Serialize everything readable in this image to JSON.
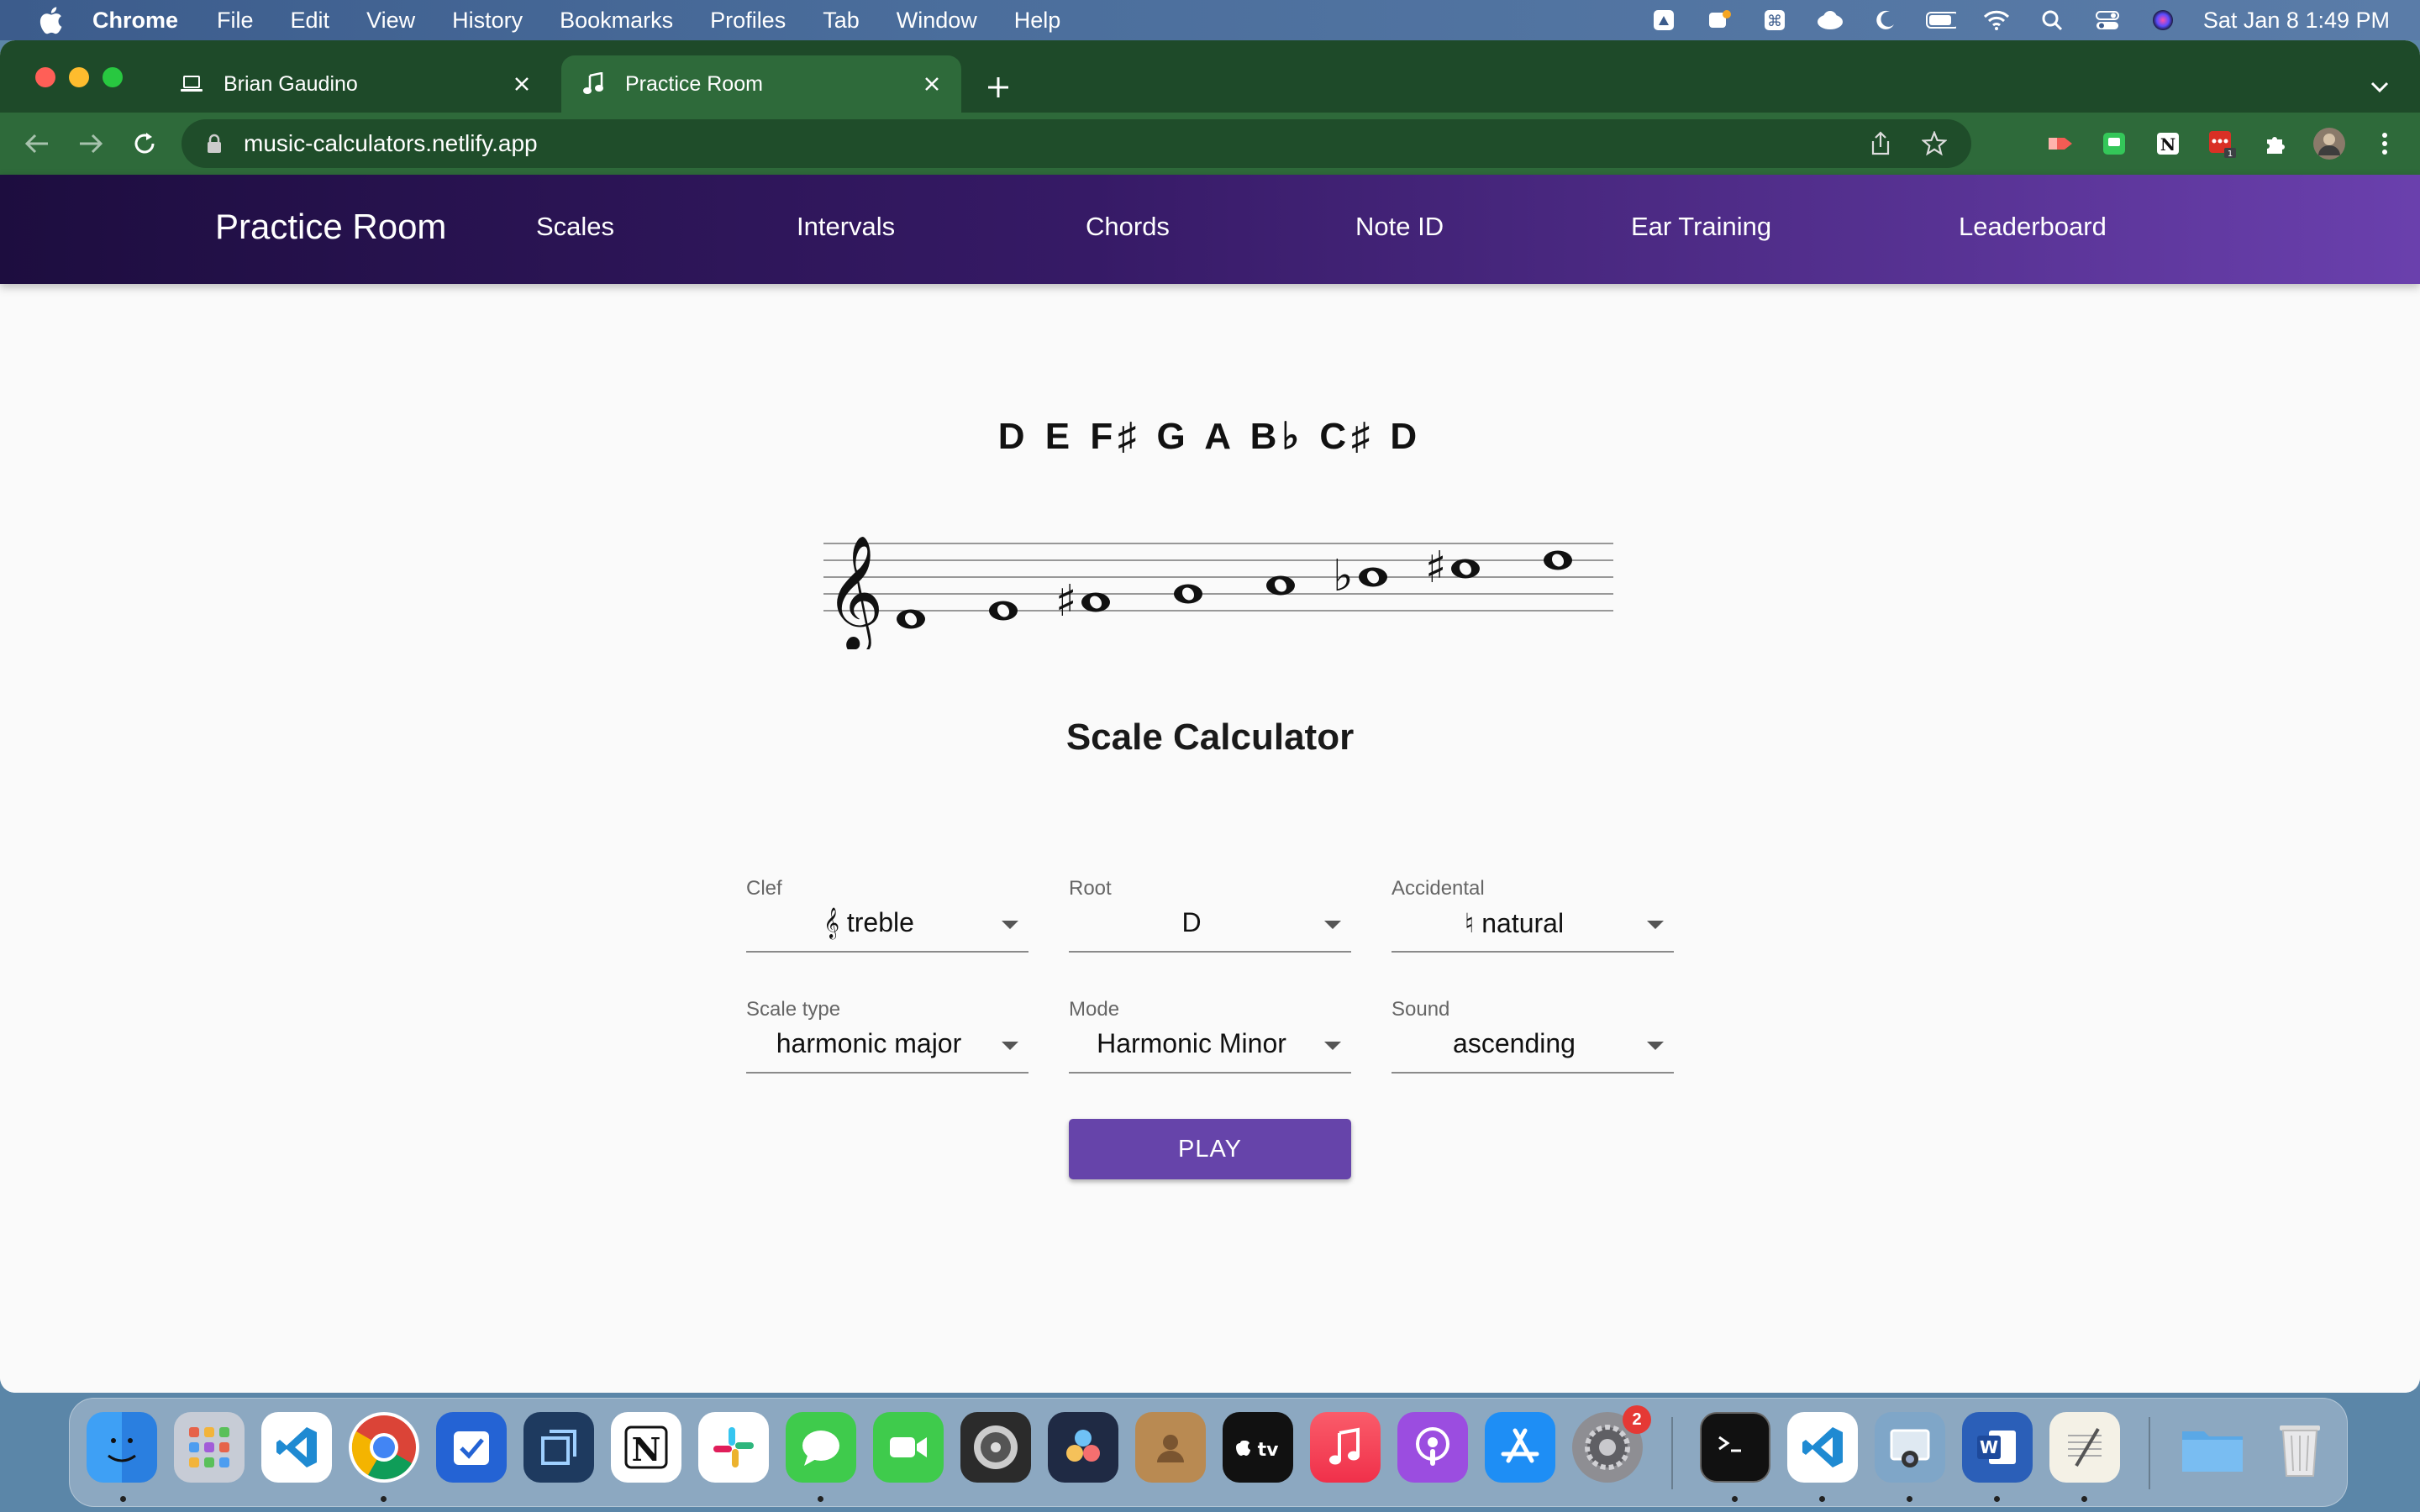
{
  "menubar": {
    "app_name": "Chrome",
    "menus": [
      "File",
      "Edit",
      "View",
      "History",
      "Bookmarks",
      "Profiles",
      "Tab",
      "Window",
      "Help"
    ],
    "clock": "Sat Jan 8  1:49 PM"
  },
  "browser": {
    "tabs": [
      {
        "title": "Brian Gaudino",
        "active": false
      },
      {
        "title": "Practice Room",
        "active": true
      }
    ],
    "url": "music-calculators.netlify.app",
    "colors": {
      "frame": "#1e4a29",
      "toolbar": "#2e6a3a"
    }
  },
  "app": {
    "brand": "Practice Room",
    "nav": [
      "Scales",
      "Intervals",
      "Chords",
      "Note ID",
      "Ear Training",
      "Leaderboard"
    ],
    "scale_notes": "D E F♯ G A B♭ C♯ D",
    "staff": {
      "clef": "treble",
      "notes": [
        {
          "name": "D4",
          "accidental": ""
        },
        {
          "name": "E4",
          "accidental": ""
        },
        {
          "name": "F4",
          "accidental": "sharp"
        },
        {
          "name": "G4",
          "accidental": ""
        },
        {
          "name": "A4",
          "accidental": ""
        },
        {
          "name": "B4",
          "accidental": "flat"
        },
        {
          "name": "C5",
          "accidental": "sharp"
        },
        {
          "name": "D5",
          "accidental": ""
        }
      ]
    },
    "calculator_title": "Scale Calculator",
    "fields": {
      "clef": {
        "label": "Clef",
        "value": "𝄞 treble"
      },
      "root": {
        "label": "Root",
        "value": "D"
      },
      "accidental": {
        "label": "Accidental",
        "value": "♮  natural"
      },
      "scale_type": {
        "label": "Scale type",
        "value": "harmonic major"
      },
      "mode": {
        "label": "Mode",
        "value": "Harmonic Minor"
      },
      "sound": {
        "label": "Sound",
        "value": "ascending"
      }
    },
    "play_label": "PLAY",
    "colors": {
      "appbar_start": "#1d0d3f",
      "appbar_end": "#6a40ad",
      "button": "#6644aa"
    }
  },
  "dock": {
    "settings_badge": "2"
  }
}
